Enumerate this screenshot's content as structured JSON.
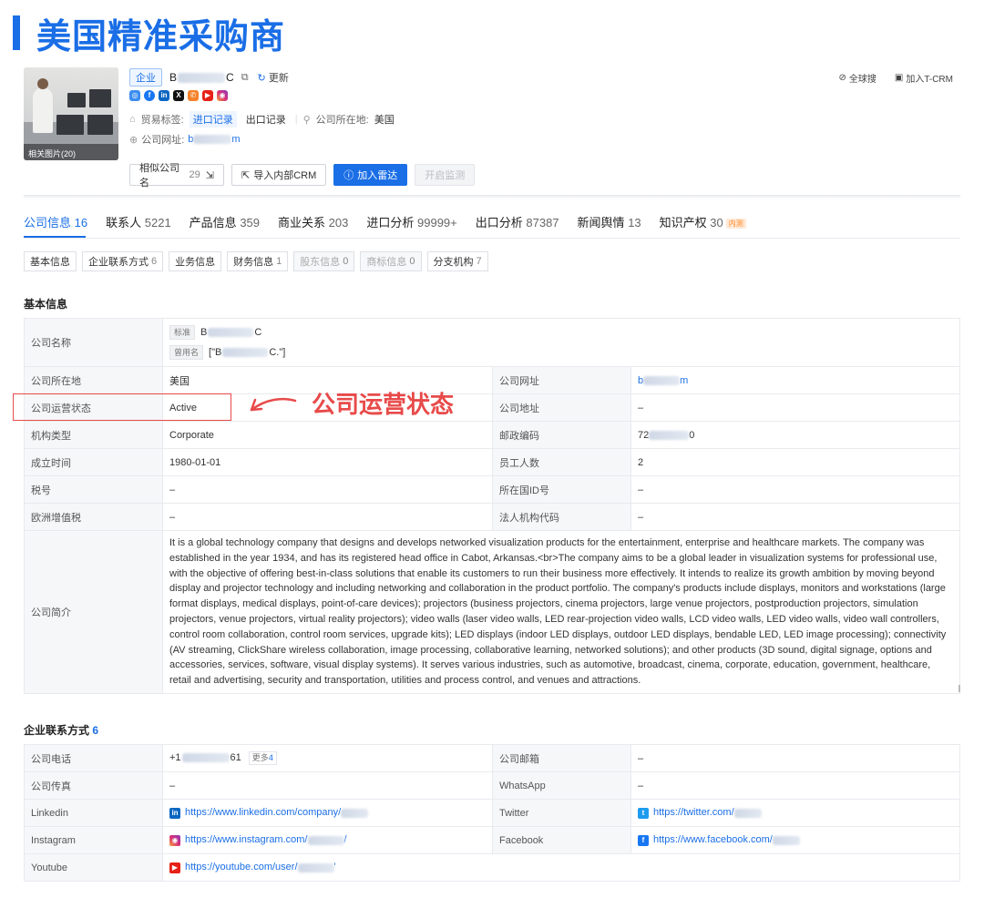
{
  "hero": {
    "title": "美国精准采购商"
  },
  "photo": {
    "caption": "相关图片(20)"
  },
  "company": {
    "type_tag": "企业",
    "name_start": "B",
    "name_end": "C",
    "update_label": "更新",
    "trade_tags_label": "贸易标签:",
    "import_label": "进口记录",
    "export_label": "出口记录",
    "location_label": "公司所在地:",
    "location_value": "美国",
    "website_label": "公司网址:",
    "website_start": "b",
    "website_end": "m"
  },
  "socials": [
    "globe-icon",
    "facebook-icon",
    "linkedin-icon",
    "x-icon",
    "phone-icon",
    "youtube-icon",
    "instagram-icon"
  ],
  "actions": {
    "similar": "相似公司名",
    "similar_count": "29",
    "import_crm": "导入内部CRM",
    "radar": "加入雷达",
    "monitor": "开启监测"
  },
  "topright": {
    "global_search": "全球搜",
    "add_tcrm": "加入T-CRM"
  },
  "tabs": [
    {
      "label": "公司信息",
      "count": "16"
    },
    {
      "label": "联系人",
      "count": "5221"
    },
    {
      "label": "产品信息",
      "count": "359"
    },
    {
      "label": "商业关系",
      "count": "203"
    },
    {
      "label": "进口分析",
      "count": "99999+"
    },
    {
      "label": "出口分析",
      "count": "87387"
    },
    {
      "label": "新闻舆情",
      "count": "13"
    },
    {
      "label": "知识产权",
      "count": "30"
    }
  ],
  "ip_badge": "内测",
  "subtabs": [
    {
      "label": "基本信息",
      "count": ""
    },
    {
      "label": "企业联系方式",
      "count": "6"
    },
    {
      "label": "业务信息",
      "count": ""
    },
    {
      "label": "财务信息",
      "count": "1"
    },
    {
      "label": "股东信息",
      "count": "0"
    },
    {
      "label": "商标信息",
      "count": "0"
    },
    {
      "label": "分支机构",
      "count": "7"
    }
  ],
  "basic": {
    "title": "基本信息",
    "company_name_label": "公司名称",
    "standard_tag": "标准",
    "used_name_tag": "曾用名",
    "used_name_prefix": "[\"B",
    "used_name_suffix": "C.\"]",
    "rows": [
      {
        "l1": "公司所在地",
        "v1": "美国",
        "l2": "公司网址",
        "v2": ""
      },
      {
        "l1": "公司运营状态",
        "v1": "Active",
        "l2": "公司地址",
        "v2": "–"
      },
      {
        "l1": "机构类型",
        "v1": "Corporate",
        "l2": "邮政编码",
        "v2": ""
      },
      {
        "l1": "成立时间",
        "v1": "1980-01-01",
        "l2": "员工人数",
        "v2": "2"
      },
      {
        "l1": "税号",
        "v1": "–",
        "l2": "所在国ID号",
        "v2": "–"
      },
      {
        "l1": "欧洲增值税",
        "v1": "–",
        "l2": "法人机构代码",
        "v2": "–"
      }
    ],
    "website_start": "b",
    "website_end": "m",
    "postal_start": "72",
    "postal_end": "0",
    "intro_label": "公司简介",
    "intro": "It is a global technology company that designs and develops networked visualization products for the entertainment, enterprise and healthcare markets. The company was established in the year 1934, and has its registered head office in Cabot, Arkansas.<br>The company aims to be a global leader in visualization systems for professional use, with the objective of offering best-in-class solutions that enable its customers to run their business more effectively. It intends to realize its growth ambition by moving beyond display and projector technology and including networking and collaboration in the product portfolio. The company's products include displays, monitors and workstations (large format displays, medical displays, point-of-care devices); projectors (business projectors, cinema projectors, large venue projectors, postproduction projectors, simulation projectors, venue projectors, virtual reality projectors); video walls (laser video walls, LED rear-projection video walls, LCD video walls, LED video walls, video wall controllers, control room collaboration, control room services, upgrade kits); LED displays (indoor LED displays, outdoor LED displays, bendable LED, LED image processing); connectivity (AV streaming, ClickShare wireless collaboration, image processing, collaborative learning, networked solutions); and other products (3D sound, digital signage, options and accessories, services, software, visual display systems). It serves various industries, such as automotive, broadcast, cinema, corporate, education, government, healthcare, retail and advertising, security and transportation, utilities and process control, and venues and attractions."
  },
  "annotation": {
    "text": "公司运营状态"
  },
  "contact": {
    "title": "企业联系方式",
    "count": "6",
    "phone_label": "公司电话",
    "phone_start": "+1",
    "phone_end": "61",
    "more_label": "更多",
    "more_count": "4",
    "email_label": "公司邮箱",
    "email_value": "–",
    "fax_label": "公司传真",
    "fax_value": "–",
    "whatsapp_label": "WhatsApp",
    "whatsapp_value": "–",
    "linkedin_label": "Linkedin",
    "linkedin_url": "https://www.linkedin.com/company/",
    "twitter_label": "Twitter",
    "twitter_url": "https://twitter.com/",
    "instagram_label": "Instagram",
    "instagram_url": "https://www.instagram.com/",
    "instagram_end": "/",
    "facebook_label": "Facebook",
    "facebook_url": "https://www.facebook.com/",
    "youtube_label": "Youtube",
    "youtube_url": "https://youtube.com/user/",
    "youtube_end": "'"
  },
  "colors": {
    "primary": "#1a6ee6",
    "annotation": "#e84a4a"
  }
}
